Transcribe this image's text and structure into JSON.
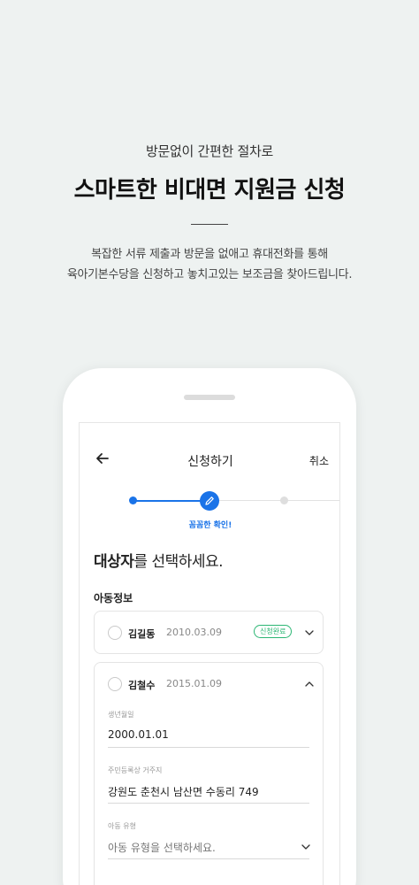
{
  "hero": {
    "subtitle": "방문없이 간편한 절차로",
    "title": "스마트한 비대면 지원금 신청",
    "desc_line1": "복잡한 서류 제출과 방문을 없애고 휴대전화를 통해",
    "desc_line2": "육아기본수당을 신청하고 놓치고있는 보조금을 찾아드립니다."
  },
  "screen": {
    "title": "신청하기",
    "cancel_label": "취소",
    "step_label": "꼼꼼한 확인!",
    "prompt_bold": "대상자",
    "prompt_rest": "를 선택하세요.",
    "section_label": "아동정보",
    "children": [
      {
        "name": "김길동",
        "dob": "2010.03.09",
        "badge": "신청완료",
        "expanded": false
      },
      {
        "name": "김철수",
        "dob": "2015.01.09",
        "expanded": true
      }
    ],
    "fields": {
      "birth_label": "생년월일",
      "birth_value": "2000.01.01",
      "address_label": "주민등록상 거주지",
      "address_value": "강원도 춘천시 남산면 수동리 749",
      "type_label": "아동 유형",
      "type_placeholder": "아동 유형을 선택하세요."
    }
  },
  "colors": {
    "background": "#eef2f1",
    "accent": "#1a73e8",
    "badge_green": "#2bb673"
  }
}
